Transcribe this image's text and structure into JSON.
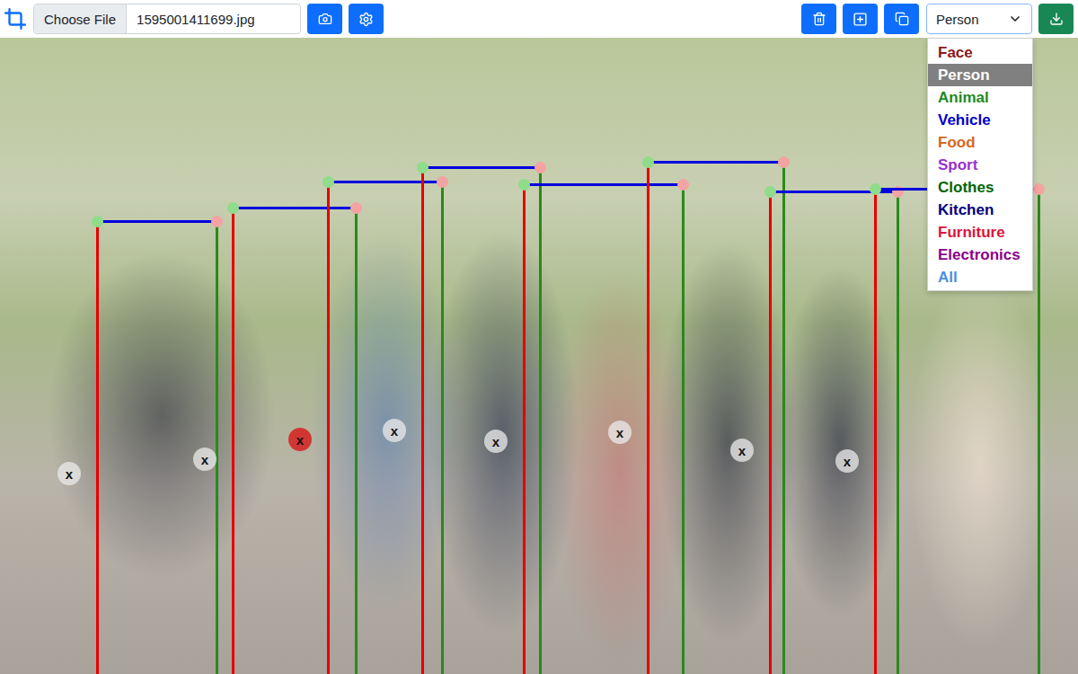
{
  "toolbar": {
    "file_button": "Choose File",
    "file_name": "1595001411699.jpg",
    "category_select": {
      "value": "Person",
      "expanded": true
    }
  },
  "category_menu": [
    {
      "label": "Face",
      "selected": false,
      "color": "#8b1a1a"
    },
    {
      "label": "Person",
      "selected": true,
      "color": "#222222"
    },
    {
      "label": "Animal",
      "selected": false,
      "color": "#1e8a1e"
    },
    {
      "label": "Vehicle",
      "selected": false,
      "color": "#0000cc"
    },
    {
      "label": "Food",
      "selected": false,
      "color": "#d2691e"
    },
    {
      "label": "Sport",
      "selected": false,
      "color": "#9932cc"
    },
    {
      "label": "Clothes",
      "selected": false,
      "color": "#006400"
    },
    {
      "label": "Kitchen",
      "selected": false,
      "color": "#000080"
    },
    {
      "label": "Furniture",
      "selected": false,
      "color": "#dc143c"
    },
    {
      "label": "Electronics",
      "selected": false,
      "color": "#8b008b"
    },
    {
      "label": "All",
      "selected": false,
      "color": "#4a90e2"
    }
  ],
  "boxes": [
    {
      "delete_label": "x",
      "selected": false
    },
    {
      "delete_label": "x",
      "selected": false
    },
    {
      "delete_label": "x",
      "selected": true
    },
    {
      "delete_label": "x",
      "selected": false
    },
    {
      "delete_label": "x",
      "selected": false
    },
    {
      "delete_label": "x",
      "selected": false
    },
    {
      "delete_label": "x",
      "selected": false
    },
    {
      "delete_label": "x",
      "selected": false
    }
  ]
}
